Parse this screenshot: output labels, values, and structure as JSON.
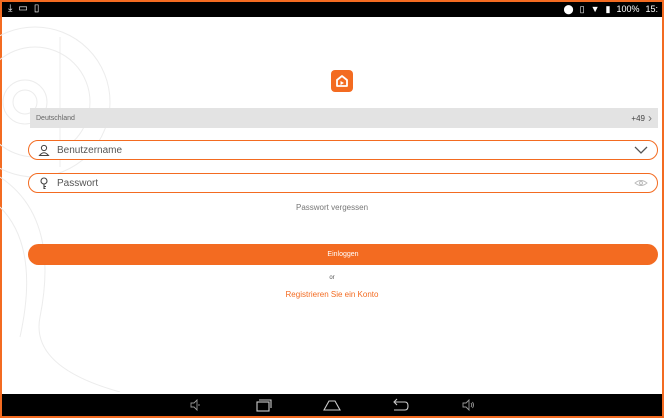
{
  "status_bar": {
    "left_icons": [
      "download-icon",
      "image-icon",
      "clipboard-icon"
    ],
    "battery": "100%",
    "time": "15:"
  },
  "country": {
    "name": "Deutschland",
    "code": "+49"
  },
  "username": {
    "placeholder": "Benutzername",
    "value": ""
  },
  "password": {
    "placeholder": "Passwort",
    "value": ""
  },
  "forgot_label": "Passwort vergessen",
  "login_label": "Einloggen",
  "or_label": "or",
  "register_label": "Registrieren Sie ein Konto",
  "colors": {
    "accent": "#f36b21",
    "country_bg": "#e3e3e3"
  },
  "nav_icons": [
    "volume-down-icon",
    "recent-apps-icon",
    "home-icon",
    "back-icon",
    "volume-up-icon"
  ]
}
